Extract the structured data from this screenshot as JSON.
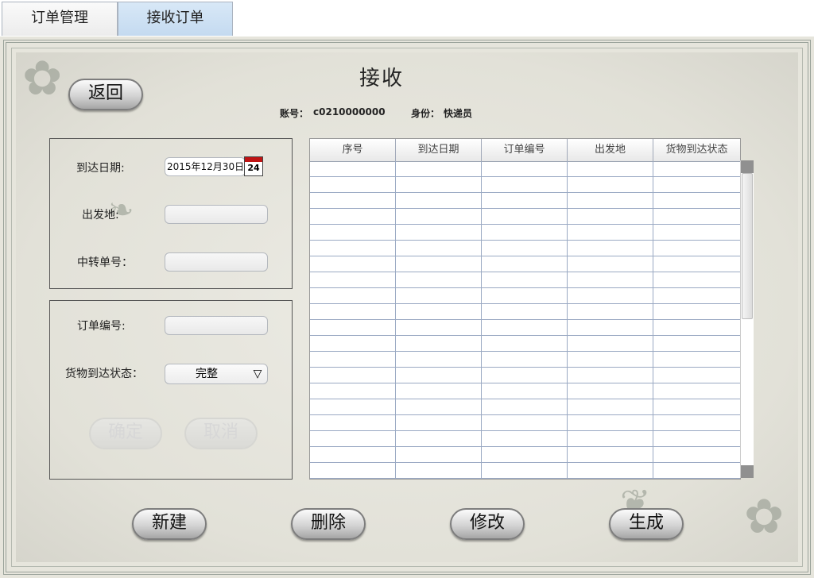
{
  "tabs": [
    {
      "label": "订单管理",
      "active": false
    },
    {
      "label": "接收订单",
      "active": true
    }
  ],
  "page": {
    "title": "接收",
    "account_label": "账号：",
    "account_value": "c0210000000",
    "role_label": "身份：",
    "role_value": "快递员"
  },
  "back_button": "返回",
  "form_upper": {
    "arrive_date_label": "到达日期:",
    "arrive_date_value": "2015年12月30日",
    "calendar_day": "24",
    "origin_label": "出发地:",
    "transfer_no_label": "中转单号："
  },
  "form_lower": {
    "order_no_label": "订单编号:",
    "status_label": "货物到达状态：",
    "status_value": "完整",
    "confirm_button": "确定",
    "cancel_button": "取消"
  },
  "table": {
    "columns": [
      "序号",
      "到达日期",
      "订单编号",
      "出发地",
      "货物到达状态"
    ],
    "rows": []
  },
  "bottom_buttons": {
    "new": "新建",
    "delete": "删除",
    "edit": "修改",
    "generate": "生成"
  },
  "icons": {
    "calendar": "calendar-icon",
    "dropdown": "chevron-down-icon"
  }
}
